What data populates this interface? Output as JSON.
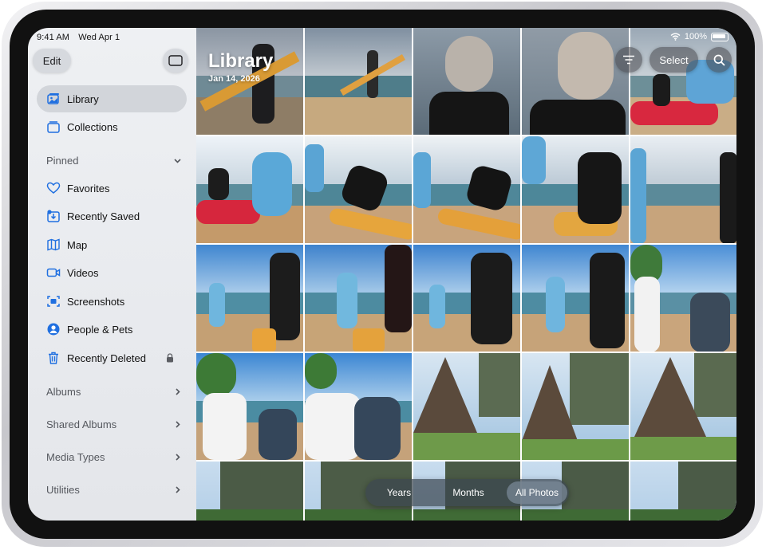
{
  "status": {
    "time": "9:41 AM",
    "date": "Wed Apr 1",
    "battery": "100%"
  },
  "sidebar": {
    "edit_label": "Edit",
    "items": [
      {
        "label": "Library",
        "icon": "library-icon",
        "selected": true
      },
      {
        "label": "Collections",
        "icon": "collections-icon"
      }
    ],
    "pinned_label": "Pinned",
    "pinned_items": [
      {
        "label": "Favorites",
        "icon": "heart-icon"
      },
      {
        "label": "Recently Saved",
        "icon": "recently-saved-icon"
      },
      {
        "label": "Map",
        "icon": "map-icon"
      },
      {
        "label": "Videos",
        "icon": "video-icon"
      },
      {
        "label": "Screenshots",
        "icon": "screenshot-icon"
      },
      {
        "label": "People & Pets",
        "icon": "person-icon"
      },
      {
        "label": "Recently Deleted",
        "icon": "trash-icon",
        "locked": true
      }
    ],
    "sections": [
      "Albums",
      "Shared Albums",
      "Media Types",
      "Utilities"
    ]
  },
  "main": {
    "title": "Library",
    "date": "Jan 14, 2026",
    "select_label": "Select"
  },
  "view_switcher": {
    "options": [
      "Years",
      "Months",
      "All Photos"
    ],
    "selected": "All Photos"
  },
  "colors": {
    "accent": "#1f6fe0",
    "sidebar_bg": "#eef0f3"
  }
}
